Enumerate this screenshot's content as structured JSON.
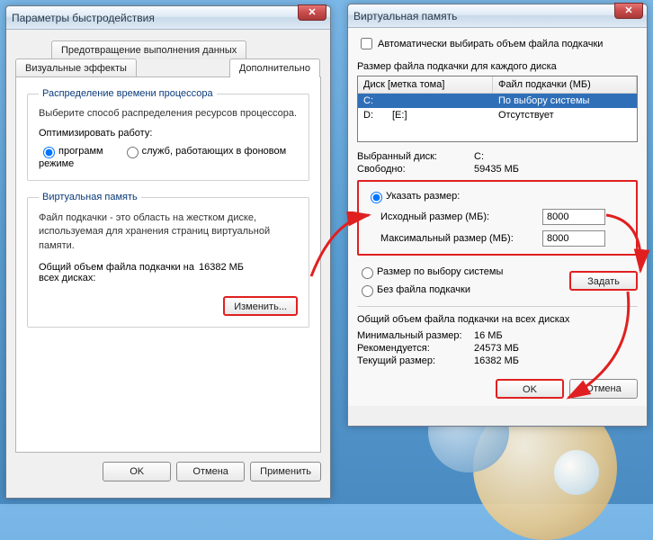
{
  "left": {
    "title": "Параметры быстродействия",
    "tabs": {
      "dep": "Предотвращение выполнения данных",
      "visual": "Визуальные эффекты",
      "advanced": "Дополнительно"
    },
    "cpu": {
      "legend": "Распределение времени процессора",
      "desc": "Выберите способ распределения ресурсов процессора.",
      "opt_label": "Оптимизировать работу:",
      "radio_programs": "программ",
      "radio_services": "служб, работающих в фоновом режиме"
    },
    "vm": {
      "legend": "Виртуальная память",
      "desc": "Файл подкачки - это область на жестком диске, используемая для хранения страниц виртуальной памяти.",
      "total_label": "Общий объем файла подкачки на всех дисках:",
      "total_value": "16382 МБ",
      "change": "Изменить..."
    },
    "buttons": {
      "ok": "OK",
      "cancel": "Отмена",
      "apply": "Применить"
    }
  },
  "right": {
    "title": "Виртуальная память",
    "auto_label": "Автоматически выбирать объем файла подкачки",
    "size_header": "Размер файла подкачки для каждого диска",
    "col_drive": "Диск [метка тома]",
    "col_paging": "Файл подкачки (МБ)",
    "drives": [
      {
        "letter": "C:",
        "label": "",
        "paging": "По выбору системы",
        "selected": true
      },
      {
        "letter": "D:",
        "label": "[E:]",
        "paging": "Отсутствует",
        "selected": false
      }
    ],
    "selected_drive_label": "Выбранный диск:",
    "selected_drive_value": "C:",
    "free_label": "Свободно:",
    "free_value": "59435 МБ",
    "custom": {
      "radio_custom": "Указать размер:",
      "initial_label": "Исходный размер (МБ):",
      "initial_value": "8000",
      "max_label": "Максимальный размер (МБ):",
      "max_value": "8000"
    },
    "radio_system": "Размер по выбору системы",
    "radio_none": "Без файла подкачки",
    "set_btn": "Задать",
    "total_header": "Общий объем файла подкачки на всех дисках",
    "min_label": "Минимальный размер:",
    "min_value": "16 МБ",
    "rec_label": "Рекомендуется:",
    "rec_value": "24573 МБ",
    "cur_label": "Текущий размер:",
    "cur_value": "16382 МБ",
    "buttons": {
      "ok": "OK",
      "cancel": "Отмена"
    }
  }
}
